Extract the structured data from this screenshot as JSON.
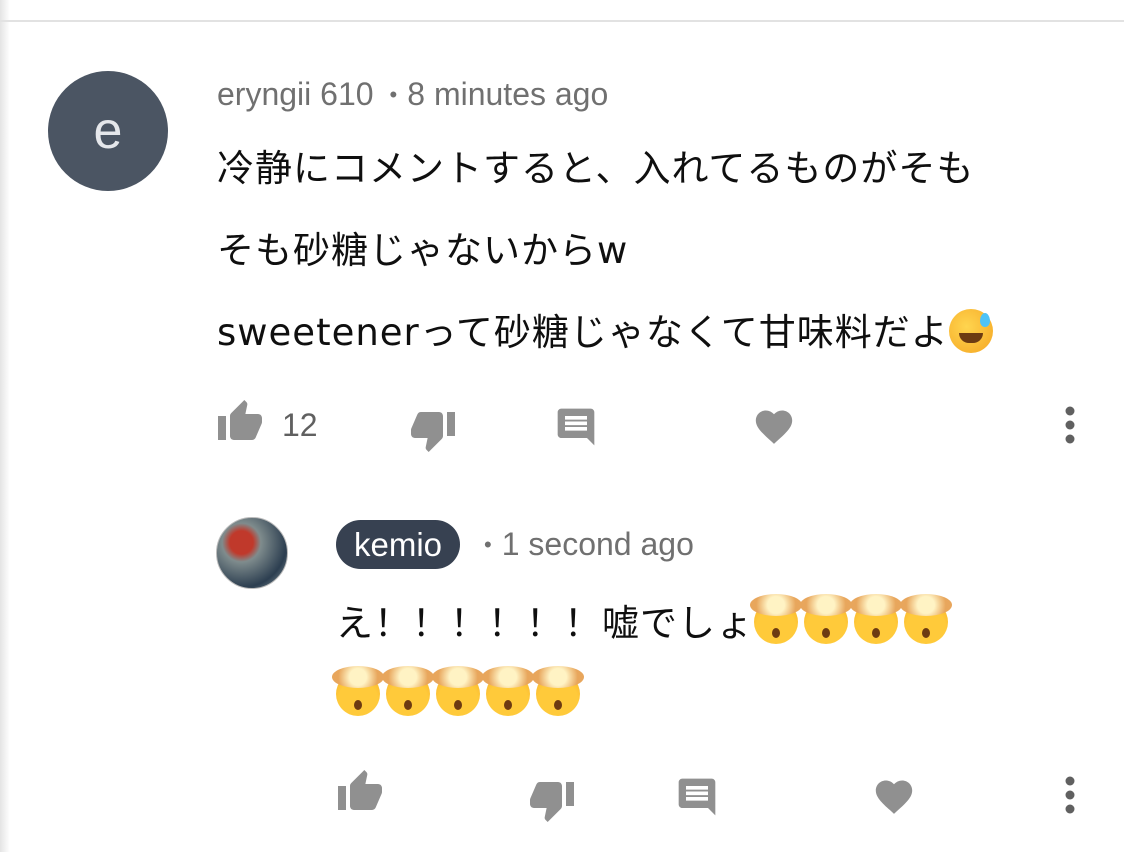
{
  "comment": {
    "avatar_letter": "e",
    "author": "eryngii 610",
    "time": "8 minutes ago",
    "lines": [
      "冷静にコメントすると、入れてるものがそも",
      "そも砂糖じゃないからw",
      "sweetenerって砂糖じゃなくて甘味料だよ"
    ],
    "likes": "12"
  },
  "reply": {
    "author": "kemio",
    "time": "1 second ago",
    "line1": "え！！！！！！嘘でしょ",
    "line1_emoji_count": 4,
    "line2_emoji_count": 5
  },
  "colors": {
    "avatar_bg": "#4b5563",
    "pill_bg": "#374151",
    "icon": "#909090"
  },
  "icons": [
    "thumb-up-icon",
    "thumb-down-icon",
    "reply-icon",
    "heart-icon",
    "more-vert-icon"
  ]
}
